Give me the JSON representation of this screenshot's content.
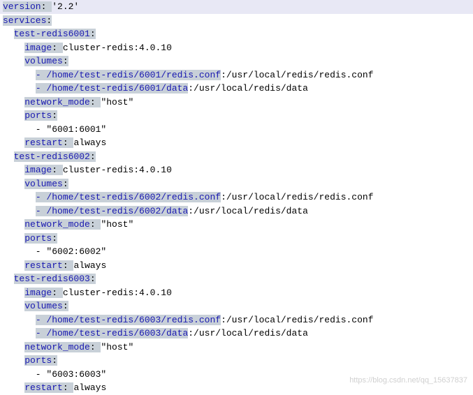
{
  "keys": {
    "version": "version",
    "services": "services",
    "image": "image",
    "volumes": "volumes",
    "network_mode": "network_mode",
    "ports": "ports",
    "restart": "restart"
  },
  "top": {
    "version": "'2.2'",
    "service1": "test-redis6001",
    "service2": "test-redis6002",
    "service3": "test-redis6003"
  },
  "common": {
    "image": "cluster-redis:4.0.10",
    "network_mode": "\"host\"",
    "restart": "always"
  },
  "svc1": {
    "vol1a": "- /home/test-redis/6001/redis.conf",
    "vol1b": ":/usr/local/redis/redis.conf",
    "vol2a": "- /home/test-redis/6001/data",
    "vol2b": ":/usr/local/redis/data",
    "port": "\"6001:6001\""
  },
  "svc2": {
    "vol1a": "- /home/test-redis/6002/redis.conf",
    "vol1b": ":/usr/local/redis/redis.conf",
    "vol2a": "- /home/test-redis/6002/data",
    "vol2b": ":/usr/local/redis/data",
    "port": "\"6002:6002\""
  },
  "svc3": {
    "vol1a": "- /home/test-redis/6003/redis.conf",
    "vol1b": ":/usr/local/redis/redis.conf",
    "vol2a": "- /home/test-redis/6003/data",
    "vol2b": ":/usr/local/redis/data",
    "port": "\"6003:6003\""
  },
  "watermark": "https://blog.csdn.net/qq_15637837"
}
